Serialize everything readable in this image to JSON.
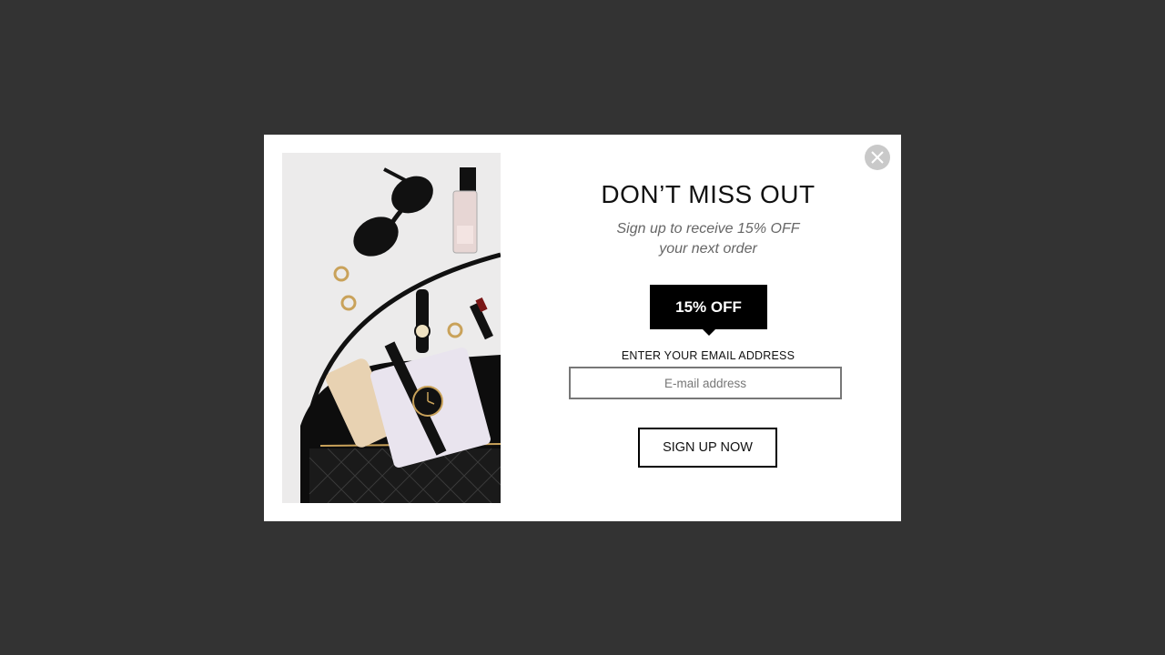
{
  "popup": {
    "title": "DON’T MISS OUT",
    "subtitle_line1": "Sign up to receive 15% OFF",
    "subtitle_line2": "your next order",
    "badge": "15% OFF",
    "email_label": "ENTER YOUR EMAIL ADDRESS",
    "email_placeholder": "E-mail address",
    "email_value": "",
    "submit_label": "SIGN UP NOW",
    "close_icon": "close-icon"
  },
  "colors": {
    "backdrop": "#333333",
    "modal_bg": "#ffffff",
    "badge_bg": "#000000",
    "badge_text": "#ffffff",
    "close_bg": "#c9c9c9"
  },
  "image": {
    "depicts": "product-photo"
  }
}
